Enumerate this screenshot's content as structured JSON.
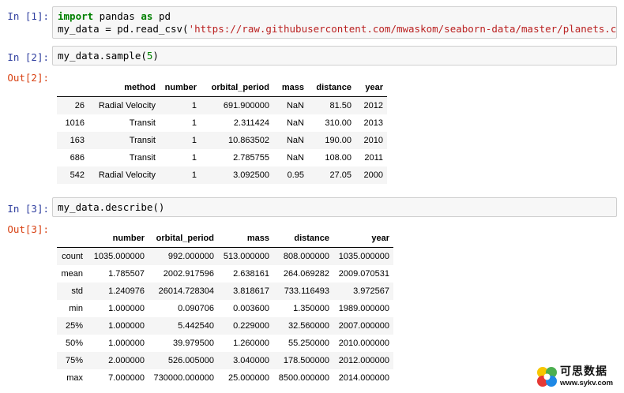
{
  "cells": [
    {
      "in_prompt": "In [1]:",
      "code_line1": {
        "kw1": "import",
        "t1": " pandas ",
        "kw2": "as",
        "t2": " pd"
      },
      "code_line2": {
        "t1": "my_data = pd.read_csv(",
        "str": "'https://raw.githubusercontent.com/mwaskom/seaborn-data/master/planets.csv'",
        "t2": ")"
      }
    },
    {
      "in_prompt": "In [2]:",
      "code": {
        "t1": "my_data.sample(",
        "num": "5",
        "t2": ")"
      },
      "out_prompt": "Out[2]:"
    },
    {
      "in_prompt": "In [3]:",
      "code": {
        "t1": "my_data.describe()"
      },
      "out_prompt": "Out[3]:"
    }
  ],
  "sample_table": {
    "columns": [
      "",
      "method",
      "number",
      "orbital_period",
      "mass",
      "distance",
      "year"
    ],
    "rows": [
      [
        "26",
        "Radial Velocity",
        "1",
        "691.900000",
        "NaN",
        "81.50",
        "2012"
      ],
      [
        "1016",
        "Transit",
        "1",
        "2.311424",
        "NaN",
        "310.00",
        "2013"
      ],
      [
        "163",
        "Transit",
        "1",
        "10.863502",
        "NaN",
        "190.00",
        "2010"
      ],
      [
        "686",
        "Transit",
        "1",
        "2.785755",
        "NaN",
        "108.00",
        "2011"
      ],
      [
        "542",
        "Radial Velocity",
        "1",
        "3.092500",
        "0.95",
        "27.05",
        "2000"
      ]
    ]
  },
  "describe_table": {
    "columns": [
      "",
      "number",
      "orbital_period",
      "mass",
      "distance",
      "year"
    ],
    "rows": [
      [
        "count",
        "1035.000000",
        "992.000000",
        "513.000000",
        "808.000000",
        "1035.000000"
      ],
      [
        "mean",
        "1.785507",
        "2002.917596",
        "2.638161",
        "264.069282",
        "2009.070531"
      ],
      [
        "std",
        "1.240976",
        "26014.728304",
        "3.818617",
        "733.116493",
        "3.972567"
      ],
      [
        "min",
        "1.000000",
        "0.090706",
        "0.003600",
        "1.350000",
        "1989.000000"
      ],
      [
        "25%",
        "1.000000",
        "5.442540",
        "0.229000",
        "32.560000",
        "2007.000000"
      ],
      [
        "50%",
        "1.000000",
        "39.979500",
        "1.260000",
        "55.250000",
        "2010.000000"
      ],
      [
        "75%",
        "2.000000",
        "526.005000",
        "3.040000",
        "178.500000",
        "2012.000000"
      ],
      [
        "max",
        "7.000000",
        "730000.000000",
        "25.000000",
        "8500.000000",
        "2014.000000"
      ]
    ]
  },
  "watermark": {
    "brand": "可思数据",
    "url": "www.sykv.com"
  },
  "colors": {
    "in_prompt": "#303f9f",
    "out_prompt": "#d84315",
    "keyword": "#008000",
    "string": "#ba2121"
  }
}
